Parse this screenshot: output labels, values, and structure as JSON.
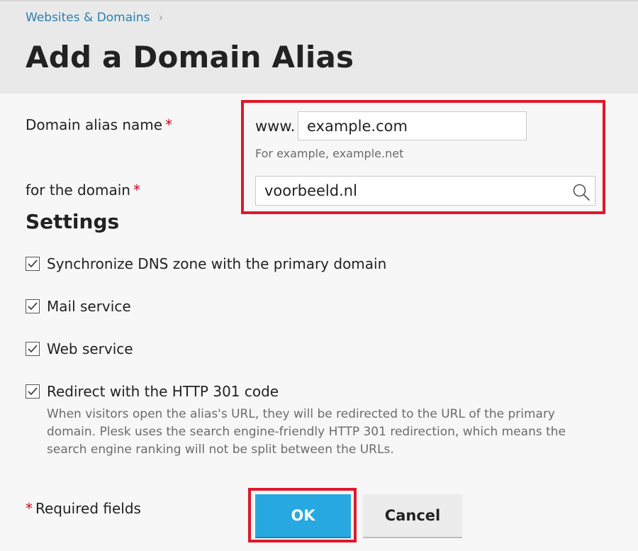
{
  "breadcrumb": {
    "item": "Websites & Domains",
    "separator": "›"
  },
  "page": {
    "title": "Add a Domain Alias"
  },
  "form": {
    "alias_label": "Domain alias name",
    "required_mark": "*",
    "www_prefix": "www.",
    "alias_value": "example.com",
    "alias_hint": "For example, example.net",
    "domain_label": "for the domain",
    "domain_value": "voorbeeld.nl"
  },
  "settings": {
    "title": "Settings",
    "options": [
      {
        "label": "Synchronize DNS zone with the primary domain",
        "checked": true
      },
      {
        "label": "Mail service",
        "checked": true
      },
      {
        "label": "Web service",
        "checked": true
      },
      {
        "label": "Redirect with the HTTP 301 code",
        "checked": true
      }
    ],
    "redirect_description": "When visitors open the alias's URL, they will be redirected to the URL of the primary domain. Plesk uses the search engine-friendly HTTP 301 redirection, which means the search engine ranking will not be split between the URLs."
  },
  "footer": {
    "required_note": "Required fields",
    "ok_label": "OK",
    "cancel_label": "Cancel"
  },
  "colors": {
    "accent": "#28a8e0",
    "highlight": "#e0182a",
    "link": "#2a7fb0",
    "required": "#d0021b"
  }
}
